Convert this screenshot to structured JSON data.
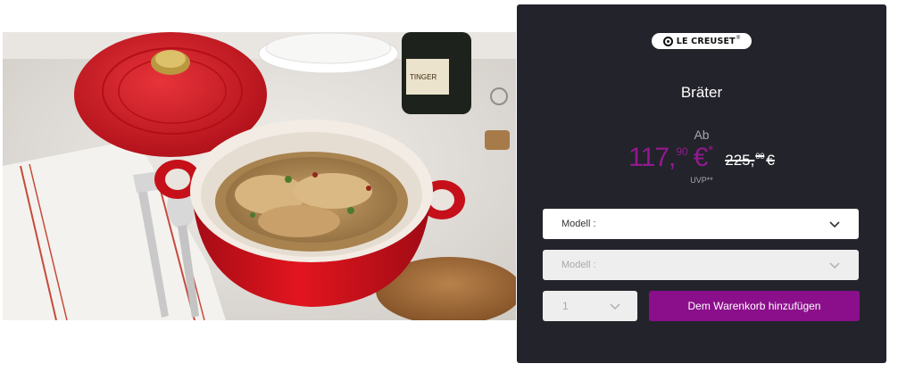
{
  "product": {
    "brand": "LE CREUSET",
    "brand_reg": "®",
    "title": "Bräter",
    "from_label": "Ab",
    "price_main": "117,",
    "price_cents": "90",
    "price_currency": "€",
    "price_star": "*",
    "old_price_main": "225,",
    "old_price_cents": "00",
    "old_price_currency": "€",
    "uvp_label": "UVP**"
  },
  "form": {
    "model_select_1": {
      "label": "Modell :",
      "state": "enabled"
    },
    "model_select_2": {
      "label": "Modell :",
      "state": "disabled"
    },
    "quantity": {
      "value": "1"
    },
    "add_to_cart_label": "Dem Warenkorb hinzufügen"
  },
  "photo": {
    "bottle_label": "TINGER"
  },
  "icons": {
    "logo": "le-creuset-logo-icon",
    "dropdown": "chevron-down-icon"
  },
  "colors": {
    "panel_bg": "#23232b",
    "price": "#93198f",
    "button": "#8b0f8b",
    "pot_red": "#d0101c"
  }
}
